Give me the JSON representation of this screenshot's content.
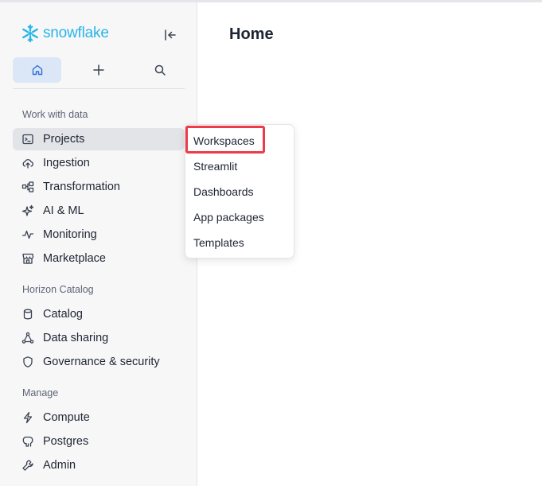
{
  "brand": {
    "name": "snowflake",
    "color": "#29b5e8"
  },
  "sidebar": {
    "top_icons": [
      "home-icon",
      "plus-icon",
      "search-icon"
    ],
    "sections": [
      {
        "title": "Work with data",
        "items": [
          {
            "label": "Projects",
            "icon": "terminal-icon",
            "active": true
          },
          {
            "label": "Ingestion",
            "icon": "cloud-upload-icon"
          },
          {
            "label": "Transformation",
            "icon": "transformation-icon"
          },
          {
            "label": "AI & ML",
            "icon": "sparkle-icon"
          },
          {
            "label": "Monitoring",
            "icon": "activity-icon"
          },
          {
            "label": "Marketplace",
            "icon": "store-icon"
          }
        ]
      },
      {
        "title": "Horizon Catalog",
        "items": [
          {
            "label": "Catalog",
            "icon": "database-icon"
          },
          {
            "label": "Data sharing",
            "icon": "share-network-icon"
          },
          {
            "label": "Governance & security",
            "icon": "shield-icon"
          }
        ]
      },
      {
        "title": "Manage",
        "items": [
          {
            "label": "Compute",
            "icon": "lightning-icon"
          },
          {
            "label": "Postgres",
            "icon": "elephant-icon"
          },
          {
            "label": "Admin",
            "icon": "wrench-icon"
          }
        ]
      }
    ]
  },
  "main": {
    "title": "Home"
  },
  "projects_menu": {
    "items": [
      "Workspaces",
      "Streamlit",
      "Dashboards",
      "App packages",
      "Templates"
    ],
    "highlighted": "Workspaces",
    "highlight_color": "#ec3b4a"
  }
}
